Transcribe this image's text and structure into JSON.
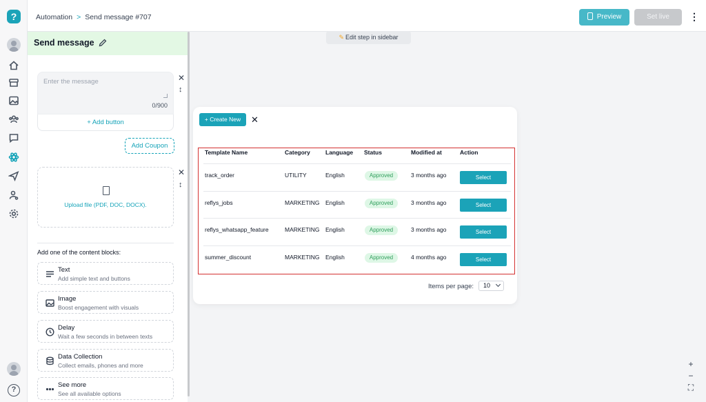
{
  "breadcrumb": {
    "parent": "Automation",
    "separator": ">",
    "current": "Send message #707"
  },
  "toolbar": {
    "preview_label": "Preview",
    "set_live_label": "Set live",
    "more_label": "⋮"
  },
  "canvas": {
    "hint_text": "Edit step in sidebar"
  },
  "sidebar": {
    "title": "Send message",
    "message_placeholder": "Enter the message",
    "char_count": "0/900",
    "add_button_label": "+ Add button",
    "add_coupon_label": "Add Coupon",
    "upload_label": "Upload file (PDF, DOC, DOCX).",
    "blocks_heading": "Add one of the content blocks:",
    "blocks": [
      {
        "icon": "text-lines-icon",
        "title": "Text",
        "subtitle": "Add simple text and buttons"
      },
      {
        "icon": "image-icon",
        "title": "Image",
        "subtitle": "Boost engagement with visuals"
      },
      {
        "icon": "clock-icon",
        "title": "Delay",
        "subtitle": "Wait a few seconds in between texts"
      },
      {
        "icon": "database-icon",
        "title": "Data Collection",
        "subtitle": "Collect emails, phones and more"
      },
      {
        "icon": "more-dots-icon",
        "title": "See more",
        "subtitle": "See all available options"
      }
    ]
  },
  "templates": {
    "create_label": "+ Create New",
    "columns": [
      "Template Name",
      "Category",
      "Language",
      "Status",
      "Modified at",
      "Action"
    ],
    "rows": [
      {
        "name": "track_order",
        "category": "UTILITY",
        "language": "English",
        "status": "Approved",
        "modified": "3 months ago",
        "action": "Select"
      },
      {
        "name": "reflys_jobs",
        "category": "MARKETING",
        "language": "English",
        "status": "Approved",
        "modified": "3 months ago",
        "action": "Select"
      },
      {
        "name": "reflys_whatsapp_feature",
        "category": "MARKETING",
        "language": "English",
        "status": "Approved",
        "modified": "3 months ago",
        "action": "Select"
      },
      {
        "name": "summer_discount",
        "category": "MARKETING",
        "language": "English",
        "status": "Approved",
        "modified": "4 months ago",
        "action": "Select"
      }
    ],
    "items_per_page_label": "Items per page:",
    "items_per_page_value": "10"
  },
  "zoom": {
    "zoom_in": "+",
    "zoom_out": "−"
  },
  "colors": {
    "accent": "#1ba3b8",
    "approved_bg": "#def7e6",
    "approved_text": "#2e9e5b",
    "highlight_border": "#d32f2f",
    "panel_header": "#e3f8e4"
  }
}
